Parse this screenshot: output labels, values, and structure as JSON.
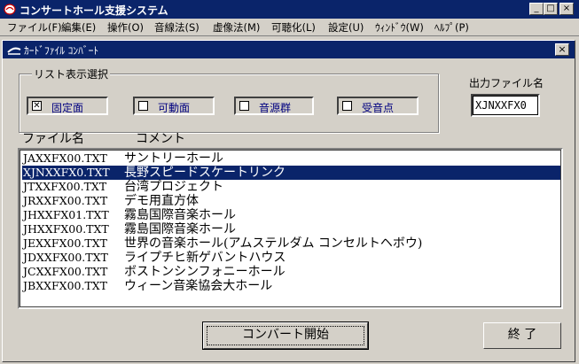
{
  "window": {
    "title": "コンサートホール支援システム"
  },
  "menu": [
    {
      "label": "ファイル(F)"
    },
    {
      "label": "編集(E)"
    },
    {
      "label": "操作(O)"
    },
    {
      "label": "音線法(S)"
    },
    {
      "label": "虚像法(M)"
    },
    {
      "label": "可聴化(L)"
    },
    {
      "label": "設定(U)"
    },
    {
      "label": "ｳｨﾝﾄﾞｳ(W)"
    },
    {
      "label": "ﾍﾙﾌﾟ(P)"
    }
  ],
  "dialog": {
    "title": "ｶｰﾄﾞﾌｧｲﾙ ｺﾝﾊﾞｰﾄ",
    "group_label": "リスト表示選択",
    "checkboxes": [
      {
        "label": "固定面",
        "checked": true
      },
      {
        "label": "可動面",
        "checked": false
      },
      {
        "label": "音源群",
        "checked": false
      },
      {
        "label": "受音点",
        "checked": false
      }
    ],
    "output_label": "出力ファイル名",
    "output_value": "XJNXXFX0",
    "col_file": "ファイル名",
    "col_comment": "コメント",
    "rows": [
      {
        "file": "JAXXFX00.TXT",
        "comment": "サントリーホール",
        "selected": false
      },
      {
        "file": "XJNXXFX0.TXT",
        "comment": "長野スピードスケートリンク",
        "selected": true
      },
      {
        "file": "JTXXFX00.TXT",
        "comment": "台湾プロジェクト",
        "selected": false
      },
      {
        "file": "JRXXFX00.TXT",
        "comment": "デモ用直方体",
        "selected": false
      },
      {
        "file": "JHXXFX01.TXT",
        "comment": "霧島国際音楽ホール",
        "selected": false
      },
      {
        "file": "JHXXFX00.TXT",
        "comment": "霧島国際音楽ホール",
        "selected": false
      },
      {
        "file": "JEXXFX00.TXT",
        "comment": "世界の音楽ホール(アムステルダム コンセルトヘボウ)",
        "selected": false
      },
      {
        "file": "JDXXFX00.TXT",
        "comment": "ライプチヒ新ゲバントハウス",
        "selected": false
      },
      {
        "file": "JCXXFX00.TXT",
        "comment": "ボストンシンフォニーホール",
        "selected": false
      },
      {
        "file": "JBXXFX00.TXT",
        "comment": "ウィーン音楽協会大ホール",
        "selected": false
      }
    ],
    "convert_button": "コンバート開始",
    "exit_button": "終 了"
  }
}
